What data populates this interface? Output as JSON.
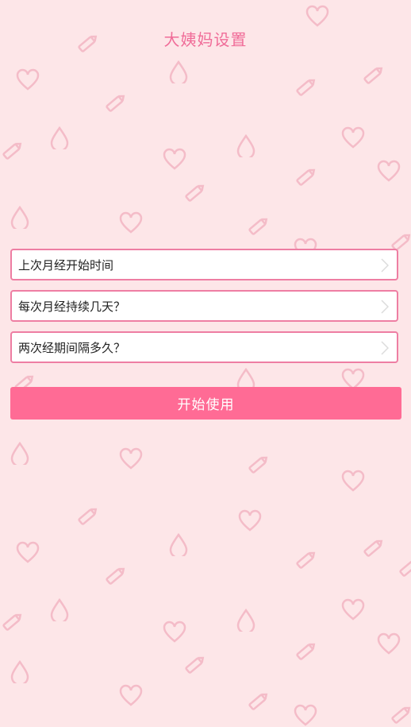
{
  "header": {
    "title": "大姨妈设置"
  },
  "settings": [
    {
      "label": "上次月经开始时间",
      "icon": "chevron-right-icon"
    },
    {
      "label": "每次月经持续几天？",
      "icon": "chevron-right-icon"
    },
    {
      "label": "两次经期间隔多久？",
      "icon": "chevron-right-icon"
    }
  ],
  "actions": {
    "start_label": "开始使用"
  },
  "colors": {
    "background": "#fde6e8",
    "accent": "#ff6b95",
    "title": "#f06c98",
    "row_border": "#ee7ea3",
    "pattern": "#f4bcc8"
  },
  "background_pattern_icons": [
    "drop-icon",
    "heart-icon",
    "pencil-icon"
  ]
}
